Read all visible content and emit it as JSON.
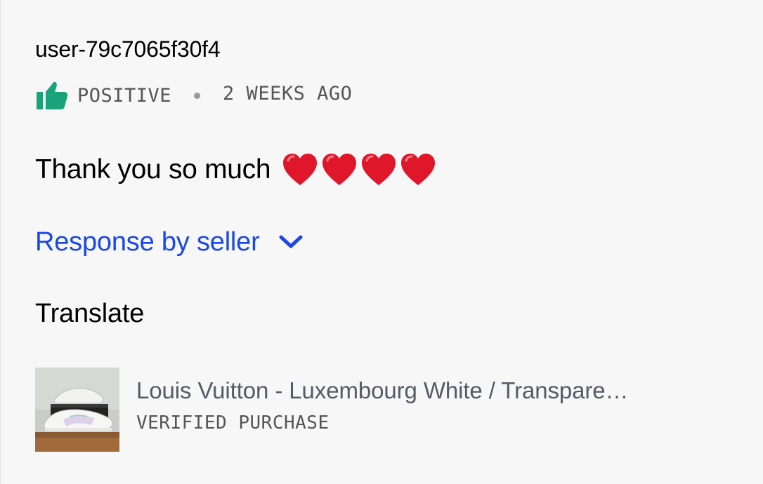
{
  "review": {
    "username": "user-79c7065f30f4",
    "sentiment": "POSITIVE",
    "time_ago": "2 WEEKS AGO",
    "comment_text": "Thank you so much",
    "comment_emoji": "❤️❤️❤️❤️",
    "response_label": "Response by seller",
    "translate_label": "Translate"
  },
  "product": {
    "name": "Louis Vuitton - Luxembourg White / Transpare…",
    "badge": "VERIFIED PURCHASE"
  },
  "icons": {
    "sentiment": "thumbs-up-icon",
    "response_toggle": "chevron-down-icon",
    "emoji": "red-heart-icon"
  },
  "colors": {
    "positive": "#1aa37a",
    "link": "#1a47e8",
    "heart": "#e0162b",
    "muted_text": "#555555",
    "background": "#f7f7f7"
  }
}
